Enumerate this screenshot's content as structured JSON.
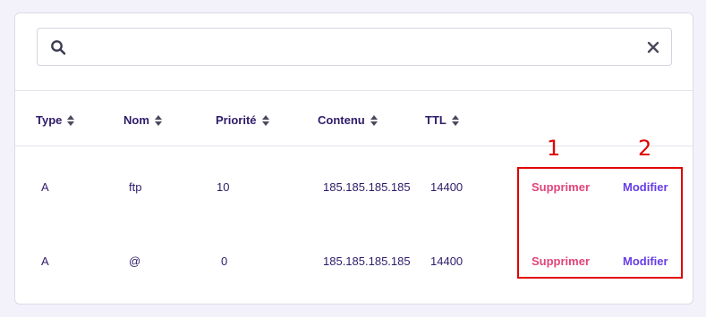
{
  "search": {
    "value": "",
    "placeholder": ""
  },
  "table": {
    "headers": [
      "Type",
      "Nom",
      "Priorité",
      "Contenu",
      "TTL"
    ],
    "rows": [
      {
        "type": "A",
        "nom": "ftp",
        "priorite": "10",
        "contenu": "185.185.185.185",
        "ttl": "14400",
        "delete_label": "Supprimer",
        "edit_label": "Modifier"
      },
      {
        "type": "A",
        "nom": "@",
        "priorite": "0",
        "contenu": "185.185.185.185",
        "ttl": "14400",
        "delete_label": "Supprimer",
        "edit_label": "Modifier"
      }
    ]
  },
  "annotations": {
    "label_1": "1",
    "label_2": "2"
  },
  "colors": {
    "text": "#2f1c6a",
    "delete": "#e0457b",
    "edit": "#673de6",
    "highlight": "#e00000"
  },
  "icons": {
    "search": "search-icon",
    "clear": "close-icon",
    "sort": "sort-icon"
  }
}
